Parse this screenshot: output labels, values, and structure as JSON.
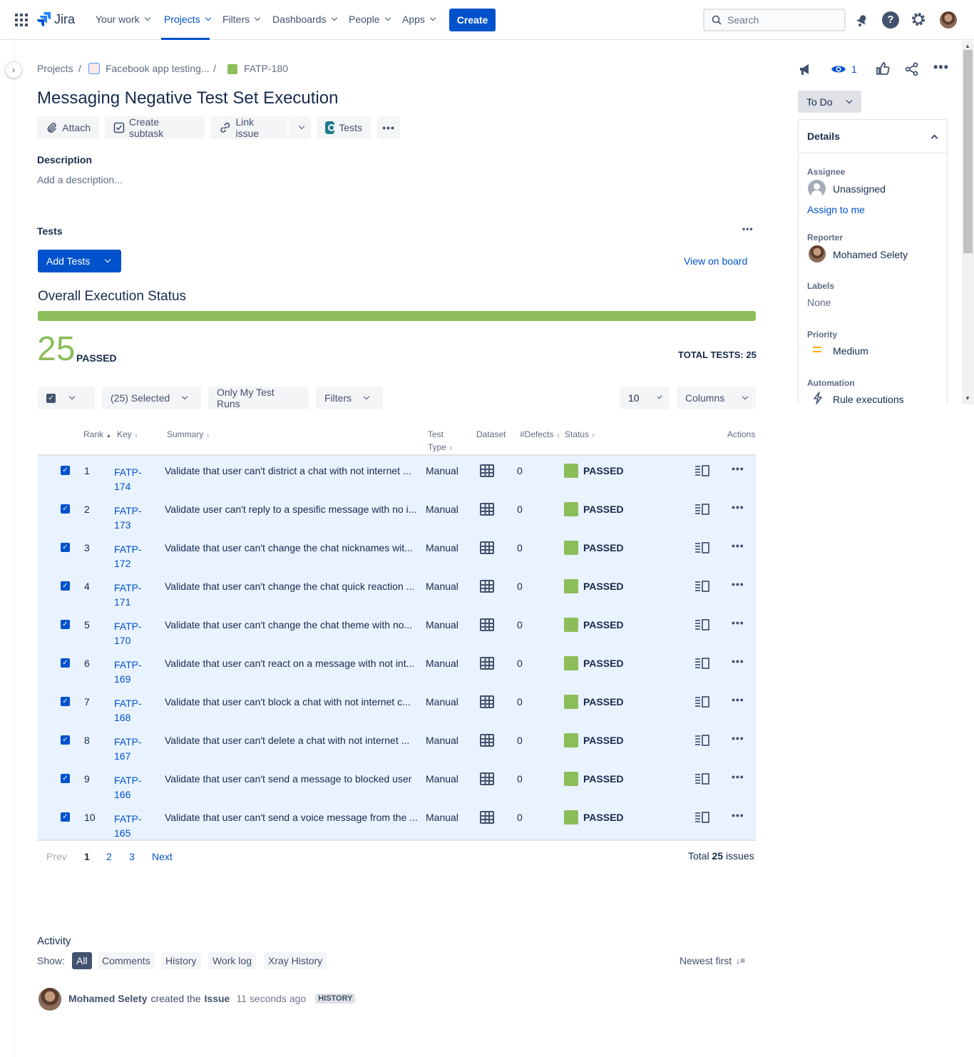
{
  "nav": {
    "logo": "Jira",
    "items": [
      "Your work",
      "Projects",
      "Filters",
      "Dashboards",
      "People",
      "Apps"
    ],
    "create_label": "Create",
    "search_placeholder": "Search"
  },
  "breadcrumb": {
    "projects": "Projects",
    "project": "Facebook app testing...",
    "issue": "FATP-180"
  },
  "issue": {
    "title": "Messaging Negative Test Set Execution",
    "toolbar": {
      "attach": "Attach",
      "create_subtask": "Create subtask",
      "link_issue": "Link issue",
      "tests": "Tests"
    },
    "description_label": "Description",
    "description_placeholder": "Add a description..."
  },
  "tests": {
    "section_label": "Tests",
    "add_tests": "Add Tests",
    "view_on_board": "View on board",
    "overall_title": "Overall Execution Status",
    "progress_passed_fraction": 1.0,
    "passed_count": "25",
    "passed_label": "PASSED",
    "total_label": "TOTAL TESTS: 25",
    "filters": {
      "selected": "(25) Selected",
      "only_mine": "Only My Test Runs",
      "filters": "Filters",
      "page_size": "10",
      "columns": "Columns"
    },
    "columns": {
      "rank": "Rank",
      "key": "Key",
      "summary": "Summary",
      "test_type_1": "Test",
      "test_type_2": "Type",
      "dataset": "Dataset",
      "defects": "#Defects",
      "status": "Status",
      "actions": "Actions"
    },
    "rows": [
      {
        "rank": "1",
        "key1": "FATP-",
        "key2": "174",
        "summary": "Validate that user can't district a chat with not internet ...",
        "type": "Manual",
        "defects": "0",
        "status": "PASSED"
      },
      {
        "rank": "2",
        "key1": "FATP-",
        "key2": "173",
        "summary": "Validate user can't reply to a spesific message with no i...",
        "type": "Manual",
        "defects": "0",
        "status": "PASSED"
      },
      {
        "rank": "3",
        "key1": "FATP-",
        "key2": "172",
        "summary": "Validate that user can't change the chat nicknames wit...",
        "type": "Manual",
        "defects": "0",
        "status": "PASSED"
      },
      {
        "rank": "4",
        "key1": "FATP-",
        "key2": "171",
        "summary": "Validate that user can't change the chat quick reaction ...",
        "type": "Manual",
        "defects": "0",
        "status": "PASSED"
      },
      {
        "rank": "5",
        "key1": "FATP-",
        "key2": "170",
        "summary": "Validate that user can't change the chat theme with no...",
        "type": "Manual",
        "defects": "0",
        "status": "PASSED"
      },
      {
        "rank": "6",
        "key1": "FATP-",
        "key2": "169",
        "summary": "Validate that user can't react on a message with not int...",
        "type": "Manual",
        "defects": "0",
        "status": "PASSED"
      },
      {
        "rank": "7",
        "key1": "FATP-",
        "key2": "168",
        "summary": "Validate that user can't block a chat with not internet c...",
        "type": "Manual",
        "defects": "0",
        "status": "PASSED"
      },
      {
        "rank": "8",
        "key1": "FATP-",
        "key2": "167",
        "summary": "Validate that user can't delete a chat with not internet ...",
        "type": "Manual",
        "defects": "0",
        "status": "PASSED"
      },
      {
        "rank": "9",
        "key1": "FATP-",
        "key2": "166",
        "summary": "Validate that user can't send a message to blocked user",
        "type": "Manual",
        "defects": "0",
        "status": "PASSED"
      },
      {
        "rank": "10",
        "key1": "FATP-",
        "key2": "165",
        "summary": "Validate that user can't send a voice message from the ...",
        "type": "Manual",
        "defects": "0",
        "status": "PASSED"
      }
    ],
    "pagination": {
      "prev": "Prev",
      "pages": [
        "1",
        "2",
        "3"
      ],
      "next": "Next",
      "total_prefix": "Total",
      "total_count": "25",
      "total_suffix": "issues"
    }
  },
  "activity": {
    "label": "Activity",
    "show_label": "Show:",
    "filters": [
      "All",
      "Comments",
      "History",
      "Work log",
      "Xray History"
    ],
    "sort": "Newest first",
    "entry": {
      "user": "Mohamed Selety",
      "action": "created the",
      "object": "Issue",
      "time": "11 seconds ago",
      "badge": "HISTORY"
    }
  },
  "sidebar": {
    "watch_count": "1",
    "status": "To Do",
    "details_label": "Details",
    "assignee_label": "Assignee",
    "assignee": "Unassigned",
    "assign_to_me": "Assign to me",
    "reporter_label": "Reporter",
    "reporter": "Mohamed Selety",
    "labels_label": "Labels",
    "labels": "None",
    "priority_label": "Priority",
    "priority": "Medium",
    "automation_label": "Automation",
    "automation": "Rule executions"
  },
  "colors": {
    "brand": "#0052cc",
    "passed": "#8cbd5a",
    "row_bg": "#e9f2ff",
    "priority_medium": "#ffab00"
  }
}
